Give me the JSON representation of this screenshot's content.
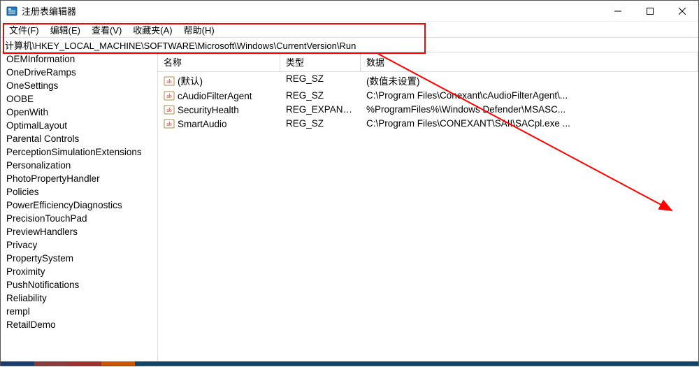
{
  "window": {
    "title": "注册表编辑器"
  },
  "menu": {
    "items": [
      "文件(F)",
      "编辑(E)",
      "查看(V)",
      "收藏夹(A)",
      "帮助(H)"
    ]
  },
  "addressbar": {
    "path": "计算机\\HKEY_LOCAL_MACHINE\\SOFTWARE\\Microsoft\\Windows\\CurrentVersion\\Run"
  },
  "tree": {
    "items": [
      "OEMInformation",
      "OneDriveRamps",
      "OneSettings",
      "OOBE",
      "OpenWith",
      "OptimalLayout",
      "Parental Controls",
      "PerceptionSimulationExtensions",
      "Personalization",
      "PhotoPropertyHandler",
      "Policies",
      "PowerEfficiencyDiagnostics",
      "PrecisionTouchPad",
      "PreviewHandlers",
      "Privacy",
      "PropertySystem",
      "Proximity",
      "PushNotifications",
      "Reliability",
      "rempl",
      "RetailDemo"
    ]
  },
  "values": {
    "columns": {
      "name": "名称",
      "type": "类型",
      "data": "数据"
    },
    "rows": [
      {
        "name": "(默认)",
        "type": "REG_SZ",
        "data": "(数值未设置)"
      },
      {
        "name": "cAudioFilterAgent",
        "type": "REG_SZ",
        "data": "C:\\Program Files\\Conexant\\cAudioFilterAgent\\..."
      },
      {
        "name": "SecurityHealth",
        "type": "REG_EXPAND_SZ",
        "data": "%ProgramFiles%\\Windows Defender\\MSASC..."
      },
      {
        "name": "SmartAudio",
        "type": "REG_SZ",
        "data": "C:\\Program Files\\CONEXANT\\SAII\\SACpl.exe ..."
      }
    ]
  },
  "annotation": {
    "box_desc": "highlight-around-menubar-and-addressbar",
    "arrow_desc": "arrow-from-addressbar-to-values-pane"
  }
}
